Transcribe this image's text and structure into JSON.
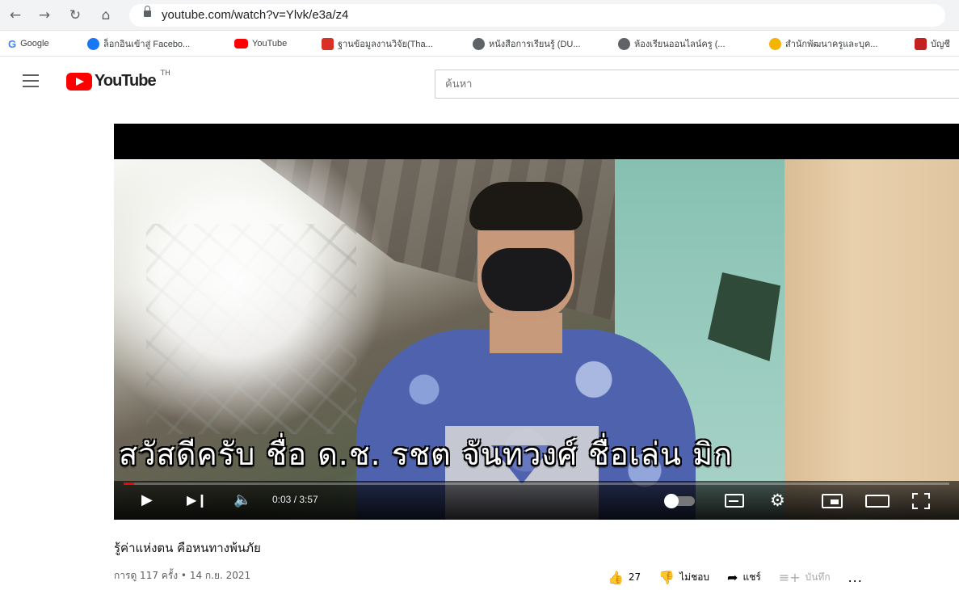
{
  "browser": {
    "url": "youtube.com/watch?v=Ylvk/e3a/z4",
    "bookmarks": [
      {
        "label": "Google",
        "color": "#4285f4",
        "icon": "google-icon"
      },
      {
        "label": "ล็อกอินเข้าสู่ Facebo...",
        "color": "#1877f2",
        "icon": "facebook-icon"
      },
      {
        "label": "YouTube",
        "color": "#ff0000",
        "icon": "youtube-icon"
      },
      {
        "label": "ฐานข้อมูลงานวิจัย(Tha...",
        "color": "#d93025",
        "icon": "database-icon"
      },
      {
        "label": "หนังสือการเรียนรู้ (DU...",
        "color": "#5f6368",
        "icon": "globe-icon"
      },
      {
        "label": "ห้องเรียนออนไลน์ครู (...",
        "color": "#5f6368",
        "icon": "globe-icon"
      },
      {
        "label": "สำนักพัฒนาครูและบุค...",
        "color": "#f4b400",
        "icon": "org-icon"
      },
      {
        "label": "บัญชี",
        "color": "#c5221f",
        "icon": "folder-icon"
      }
    ]
  },
  "header": {
    "logo_text": "YouTube",
    "region": "TH",
    "search_placeholder": "ค้นหา"
  },
  "player": {
    "subtitle": "สวัสดีครับ ชื่อ ด.ช. รชต จันทวงศ์ ชื่อเล่น มิก",
    "time": "0:03 / 3:57",
    "progress_fraction": 0.013
  },
  "video": {
    "title": "รู้ค่าแห่งตน คือหนทางพ้นภัย",
    "meta": "การดู 117 ครั้ง • 14 ก.ย. 2021",
    "likes": "27",
    "dislike_label": "ไม่ชอบ",
    "share_label": "แชร์",
    "save_label": "บันทึก",
    "more": "..."
  }
}
